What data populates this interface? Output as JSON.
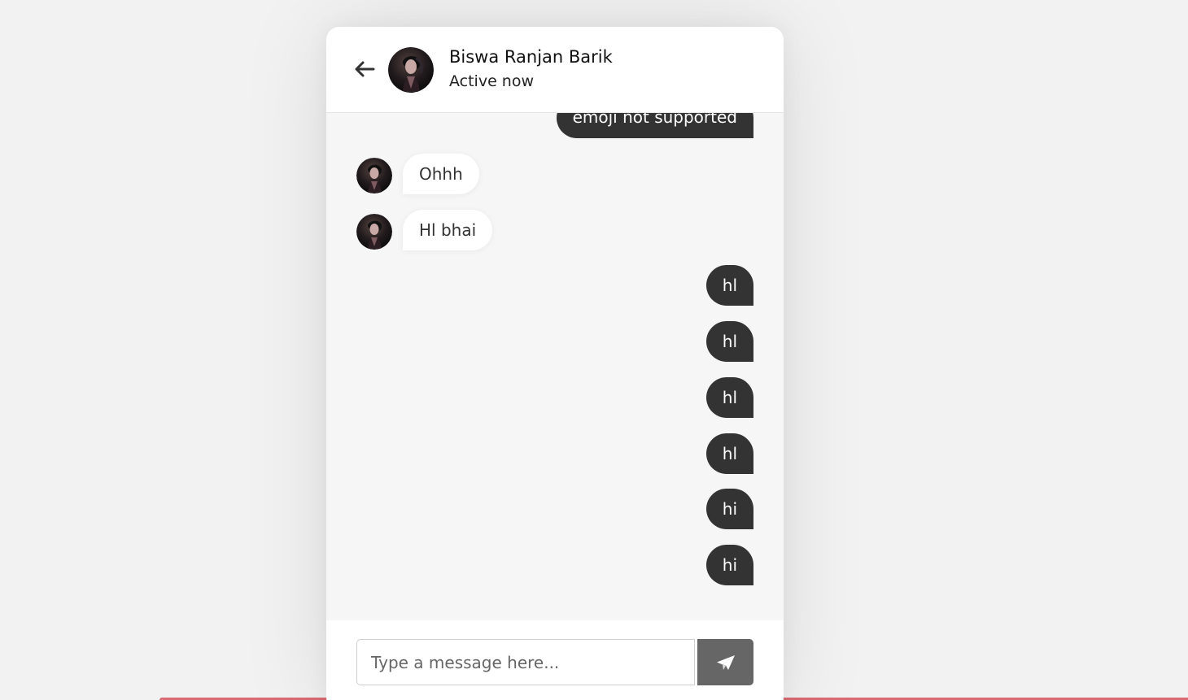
{
  "header": {
    "back_icon": "arrow-left-icon",
    "avatar_icon": "profile-photo-icon",
    "name": "Biswa Ranjan Barik",
    "status": "Active now"
  },
  "messages": [
    {
      "text": "emoji not supported",
      "direction": "outgoing"
    },
    {
      "text": "Ohhh",
      "direction": "incoming"
    },
    {
      "text": "Hl bhai",
      "direction": "incoming"
    },
    {
      "text": "hl",
      "direction": "outgoing"
    },
    {
      "text": "hl",
      "direction": "outgoing"
    },
    {
      "text": "hl",
      "direction": "outgoing"
    },
    {
      "text": "hl",
      "direction": "outgoing"
    },
    {
      "text": "hi",
      "direction": "outgoing"
    },
    {
      "text": "hi",
      "direction": "outgoing"
    }
  ],
  "composer": {
    "placeholder": "Type a message here...",
    "value": "",
    "send_icon": "send-icon"
  },
  "colors": {
    "page_background": "#f2f2f2",
    "card_background": "#f6f6f6",
    "outgoing_bubble": "#333333",
    "incoming_bubble": "#ffffff",
    "send_button": "#666666",
    "accent_line": "#d96b74"
  }
}
